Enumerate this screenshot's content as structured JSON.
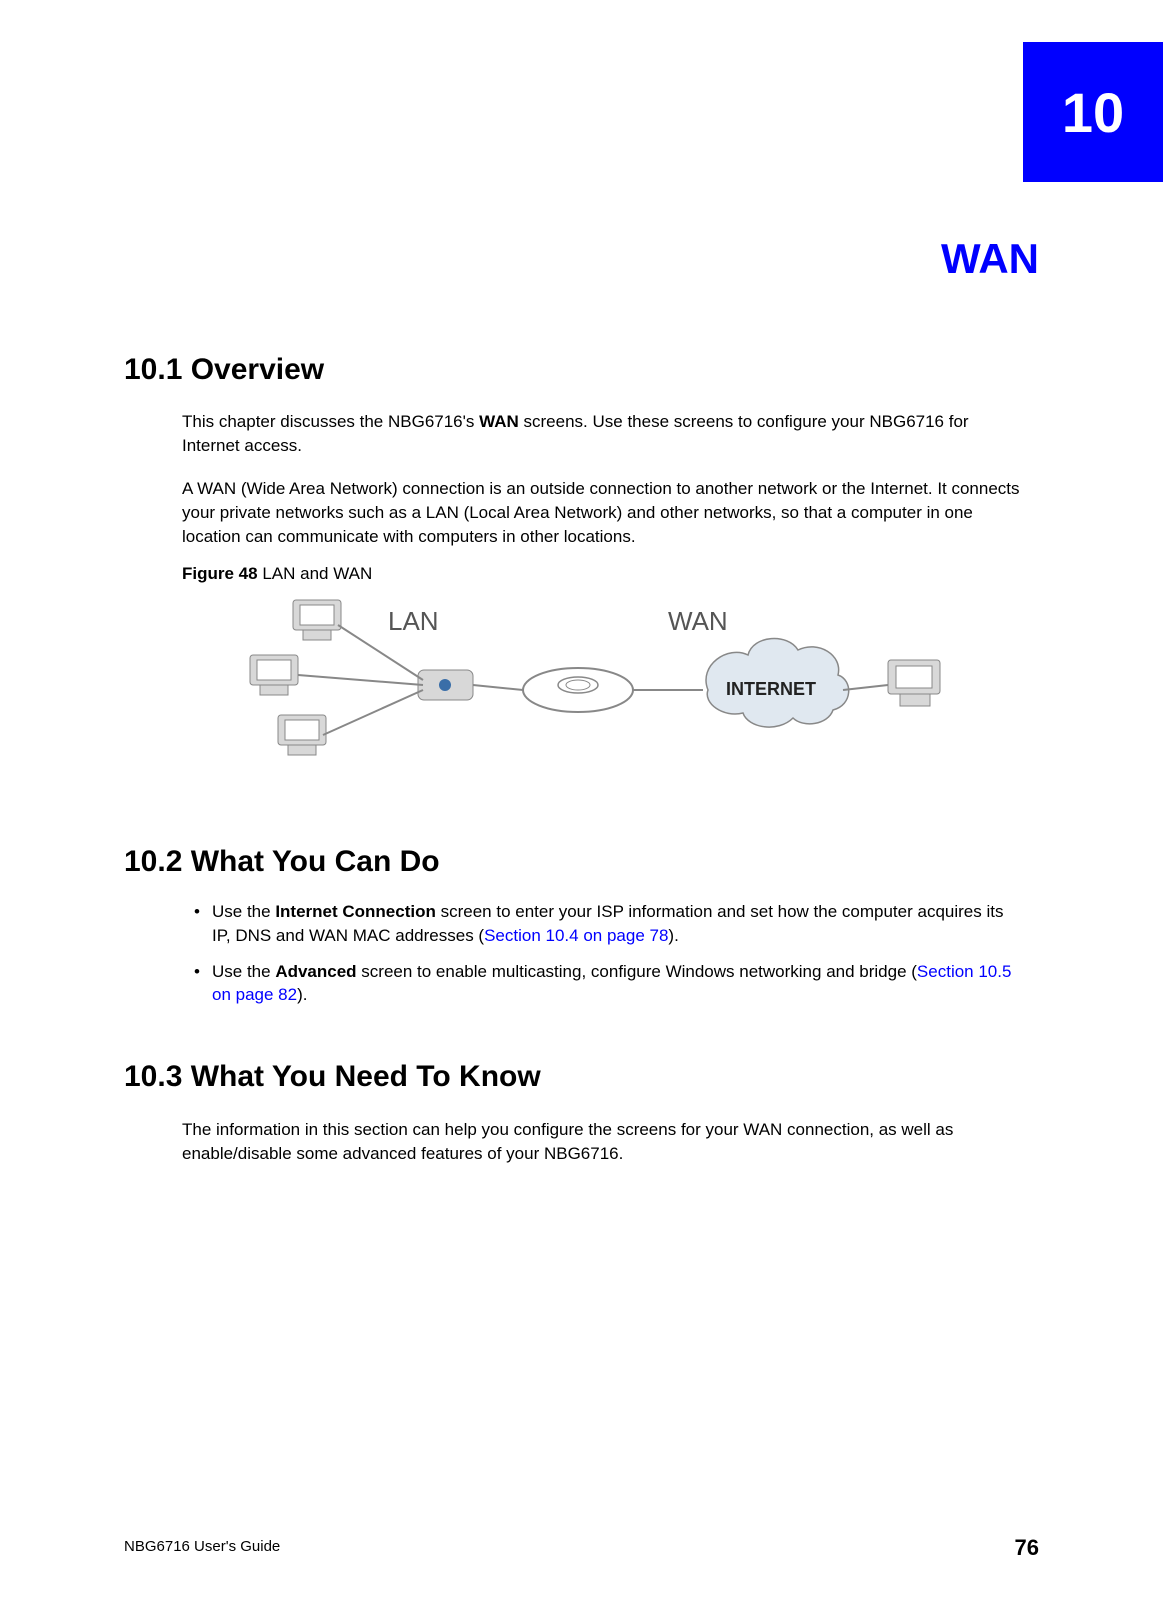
{
  "chapter": {
    "number": "10",
    "title": "WAN"
  },
  "sections": {
    "overview": {
      "heading": "10.1  Overview",
      "para1_pre": "This chapter discusses the NBG6716's ",
      "para1_bold": "WAN",
      "para1_post": " screens. Use these screens to configure your NBG6716 for Internet access.",
      "para2": "A WAN (Wide Area Network) connection is an outside connection to another network or the Internet. It connects your private networks such as a LAN (Local Area Network) and other networks, so that a computer in one location can communicate with computers in other locations."
    },
    "figure": {
      "label_bold": "Figure 48",
      "label_rest": "   LAN and WAN",
      "lan_label": "LAN",
      "wan_label": "WAN",
      "cloud_label": "INTERNET"
    },
    "whatYouCanDo": {
      "heading": "10.2  What You Can Do",
      "bullets": [
        {
          "pre": "Use the ",
          "bold": "Internet Connection",
          "mid": " screen to enter your ISP information and set how the computer acquires its IP, DNS and WAN MAC addresses (",
          "link": "Section 10.4 on page 78",
          "post": ")."
        },
        {
          "pre": "Use the ",
          "bold": "Advanced",
          "mid": " screen to enable multicasting, configure Windows networking and bridge (",
          "link": "Section 10.5 on page 82",
          "post": ")."
        }
      ]
    },
    "whatYouNeedToKnow": {
      "heading": "10.3  What You Need To Know",
      "para": "The information in this section can help you configure the screens for your WAN connection, as well as enable/disable some advanced features of your NBG6716."
    }
  },
  "footer": {
    "left": "NBG6716 User's Guide",
    "right": "76"
  }
}
